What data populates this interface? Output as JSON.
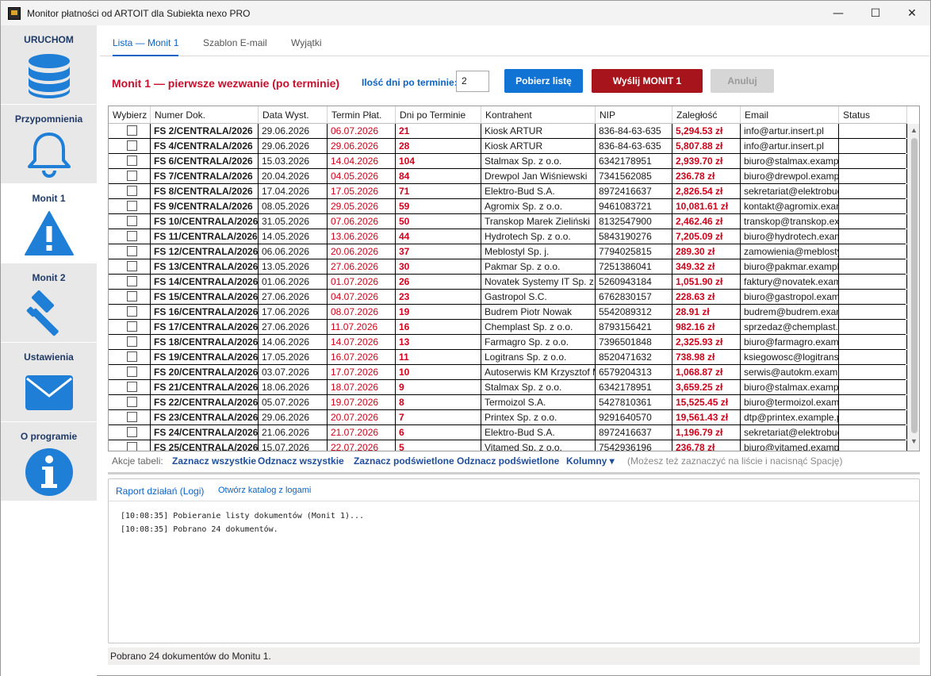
{
  "window": {
    "title": "Monitor płatności od ARTOIT dla Subiekta nexo PRO",
    "minimize": "—",
    "maximize": "☐",
    "close": "✕"
  },
  "sidebar": {
    "items": [
      {
        "label": "URUCHOM",
        "icon": "database-icon"
      },
      {
        "label": "Przypomnienia",
        "icon": "bell-icon"
      },
      {
        "label": "Monit 1",
        "icon": "warning-icon",
        "active": true
      },
      {
        "label": "Monit 2",
        "icon": "gavel-icon"
      },
      {
        "label": "Ustawienia",
        "icon": "envelope-icon"
      },
      {
        "label": "O programie",
        "icon": "info-icon"
      }
    ],
    "icon_color": "#1f7fd6"
  },
  "tabs": [
    {
      "label": "Lista — Monit 1",
      "active": true
    },
    {
      "label": "Szablon E-mail"
    },
    {
      "label": "Wyjątki"
    }
  ],
  "panel": {
    "heading": "Monit 1 — pierwsze wezwanie (po terminie)",
    "days_label": "Ilość dni po terminie:",
    "days_value": "2",
    "fetch_button": "Pobierz listę",
    "send_button": "Wyślij MONIT 1",
    "cancel_button": "Anuluj"
  },
  "table": {
    "columns": [
      "Wybierz",
      "Numer Dok.",
      "Data Wyst.",
      "Termin Płat.",
      "Dni po Terminie",
      "Kontrahent",
      "NIP",
      "Zaległość",
      "Email",
      "Status"
    ],
    "rows": [
      [
        "FS 2/CENTRALA/2026",
        "29.06.2026",
        "06.07.2026",
        "21",
        "Kiosk ARTUR",
        "836-84-63-635",
        "5,294.53 zł",
        "info@artur.insert.pl",
        ""
      ],
      [
        "FS 4/CENTRALA/2026",
        "29.06.2026",
        "29.06.2026",
        "28",
        "Kiosk ARTUR",
        "836-84-63-635",
        "5,807.88 zł",
        "info@artur.insert.pl",
        ""
      ],
      [
        "FS 6/CENTRALA/2026",
        "15.03.2026",
        "14.04.2026",
        "104",
        "Stalmax Sp. z o.o.",
        "6342178951",
        "2,939.70 zł",
        "biuro@stalmax.example.pl",
        ""
      ],
      [
        "FS 7/CENTRALA/2026",
        "20.04.2026",
        "04.05.2026",
        "84",
        "Drewpol Jan Wiśniewski",
        "7341562085",
        "236.78 zł",
        "biuro@drewpol.example.pl",
        ""
      ],
      [
        "FS 8/CENTRALA/2026",
        "17.04.2026",
        "17.05.2026",
        "71",
        "Elektro-Bud S.A.",
        "8972416637",
        "2,826.54 zł",
        "sekretariat@elektrobud.example.pl",
        ""
      ],
      [
        "FS 9/CENTRALA/2026",
        "08.05.2026",
        "29.05.2026",
        "59",
        "Agromix Sp. z o.o.",
        "9461083721",
        "10,081.61 zł",
        "kontakt@agromix.example.pl",
        ""
      ],
      [
        "FS 10/CENTRALA/2026",
        "31.05.2026",
        "07.06.2026",
        "50",
        "Transkop Marek Zieliński",
        "8132547900",
        "2,462.46 zł",
        "transkop@transkop.example.pl",
        ""
      ],
      [
        "FS 11/CENTRALA/2026",
        "14.05.2026",
        "13.06.2026",
        "44",
        "Hydrotech Sp. z o.o.",
        "5843190276",
        "7,205.09 zł",
        "biuro@hydrotech.example.pl",
        ""
      ],
      [
        "FS 12/CENTRALA/2026",
        "06.06.2026",
        "20.06.2026",
        "37",
        "Meblostyl Sp. j.",
        "7794025815",
        "289.30 zł",
        "zamowienia@meblostyl.example.pl",
        ""
      ],
      [
        "FS 13/CENTRALA/2026",
        "13.05.2026",
        "27.06.2026",
        "30",
        "Pakmar Sp. z o.o.",
        "7251386041",
        "349.32 zł",
        "biuro@pakmar.example.pl",
        ""
      ],
      [
        "FS 14/CENTRALA/2026",
        "01.06.2026",
        "01.07.2026",
        "26",
        "Novatek Systemy IT Sp. z o.o.",
        "5260943184",
        "1,051.90 zł",
        "faktury@novatek.example.pl",
        ""
      ],
      [
        "FS 15/CENTRALA/2026",
        "27.06.2026",
        "04.07.2026",
        "23",
        "Gastropol S.C.",
        "6762830157",
        "228.63 zł",
        "biuro@gastropol.example.pl",
        ""
      ],
      [
        "FS 16/CENTRALA/2026",
        "17.06.2026",
        "08.07.2026",
        "19",
        "Budrem Piotr Nowak",
        "5542089312",
        "28.91 zł",
        "budrem@budrem.example.pl",
        ""
      ],
      [
        "FS 17/CENTRALA/2026",
        "27.06.2026",
        "11.07.2026",
        "16",
        "Chemplast Sp. z o.o.",
        "8793156421",
        "982.16 zł",
        "sprzedaz@chemplast.example.pl",
        ""
      ],
      [
        "FS 18/CENTRALA/2026",
        "14.06.2026",
        "14.07.2026",
        "13",
        "Farmagro Sp. z o.o.",
        "7396501848",
        "2,325.93 zł",
        "biuro@farmagro.example.pl",
        ""
      ],
      [
        "FS 19/CENTRALA/2026",
        "17.05.2026",
        "16.07.2026",
        "11",
        "Logitrans Sp. z o.o.",
        "8520471632",
        "738.98 zł",
        "ksiegowosc@logitrans.example.pl",
        ""
      ],
      [
        "FS 20/CENTRALA/2026",
        "03.07.2026",
        "17.07.2026",
        "10",
        "Autoserwis KM Krzysztof Mazur",
        "6579204313",
        "1,068.87 zł",
        "serwis@autokm.example.pl",
        ""
      ],
      [
        "FS 21/CENTRALA/2026",
        "18.06.2026",
        "18.07.2026",
        "9",
        "Stalmax Sp. z o.o.",
        "6342178951",
        "3,659.25 zł",
        "biuro@stalmax.example.pl",
        ""
      ],
      [
        "FS 22/CENTRALA/2026",
        "05.07.2026",
        "19.07.2026",
        "8",
        "Termoizol S.A.",
        "5427810361",
        "15,525.45 zł",
        "biuro@termoizol.example.pl",
        ""
      ],
      [
        "FS 23/CENTRALA/2026",
        "29.06.2026",
        "20.07.2026",
        "7",
        "Printex Sp. z o.o.",
        "9291640570",
        "19,561.43 zł",
        "dtp@printex.example.pl",
        ""
      ],
      [
        "FS 24/CENTRALA/2026",
        "21.06.2026",
        "21.07.2026",
        "6",
        "Elektro-Bud S.A.",
        "8972416637",
        "1,196.79 zł",
        "sekretariat@elektrobud.example.pl",
        ""
      ],
      [
        "FS 25/CENTRALA/2026",
        "15.07.2026",
        "22.07.2026",
        "5",
        "Vitamed Sp. z o.o.",
        "7542936196",
        "236.78 zł",
        "biuro@vitamed.example.pl",
        ""
      ]
    ]
  },
  "table_actions": {
    "label": "Akcje tabeli:",
    "select_all": "Zaznacz wszystkie",
    "deselect_all": "Odznacz wszystkie",
    "select_highlighted": "Zaznacz podświetlone",
    "deselect_highlighted": "Odznacz podświetlone",
    "columns": "Kolumny ▾",
    "hint": "(Możesz też zaznaczyć na liście i nacisnąć Spację)"
  },
  "logs": {
    "tab_report": "Raport działań (Logi)",
    "tab_open_folder": "Otwórz katalog z logami",
    "lines": [
      "[10:08:35] Pobieranie listy dokumentów (Monit 1)...",
      "[10:08:35] Pobrano 24 dokumentów."
    ]
  },
  "status_bar": "Pobrano 24 dokumentów do Monitu 1."
}
